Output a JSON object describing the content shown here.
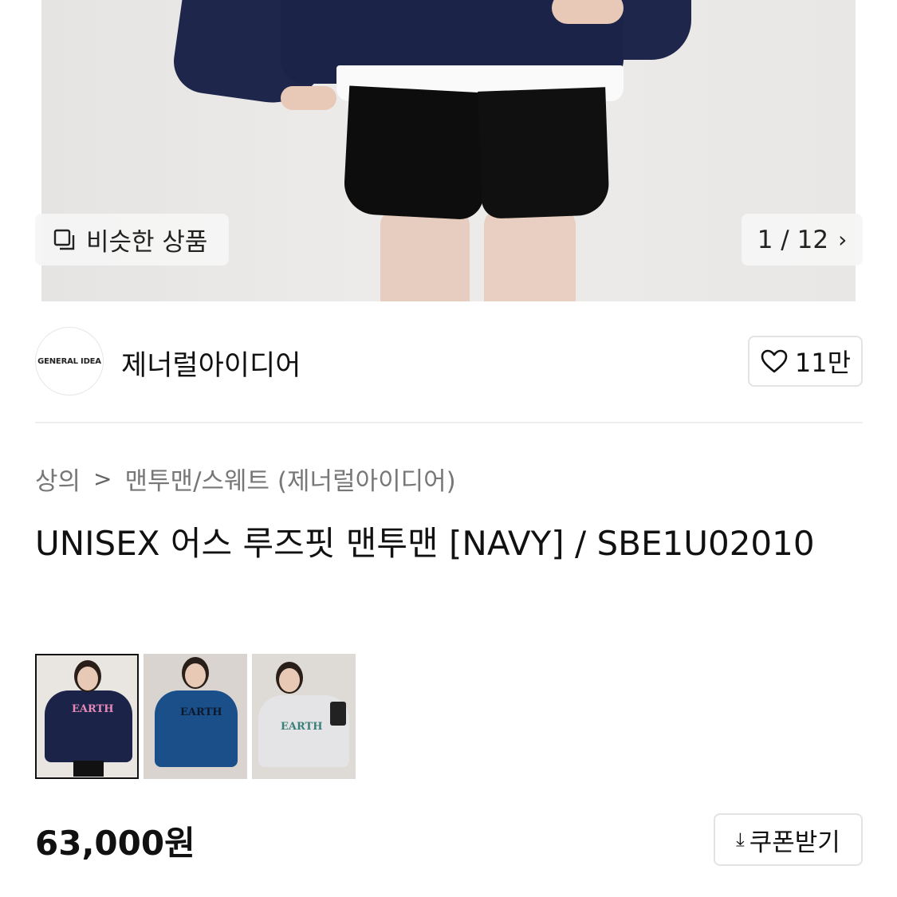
{
  "gallery": {
    "similar_label": "비슷한 상품",
    "counter": "1 / 12",
    "icons": {
      "similar": "similar-items-icon",
      "next": "chevron-right-icon"
    }
  },
  "brand": {
    "logo_text": "GENERAL IDEA",
    "name": "제너럴아이디어",
    "like_count": "11만"
  },
  "breadcrumb": {
    "items": [
      "상의",
      "맨투맨/스웨트 (제너럴아이디어)"
    ],
    "separator": ">"
  },
  "product": {
    "title": "UNISEX 어스 루즈핏 맨투맨 [NAVY] / SBE1U02010",
    "thumbnails": [
      {
        "print_text": "EARTH",
        "selected": true
      },
      {
        "print_text": "EARTH",
        "selected": false
      },
      {
        "print_text": "EARTH",
        "selected": false
      }
    ],
    "price": "63,000원",
    "coupon_label": "쿠폰받기"
  },
  "colors": {
    "navy": "#1c2348",
    "border": "#e3e3e3",
    "muted_text": "#777777"
  }
}
